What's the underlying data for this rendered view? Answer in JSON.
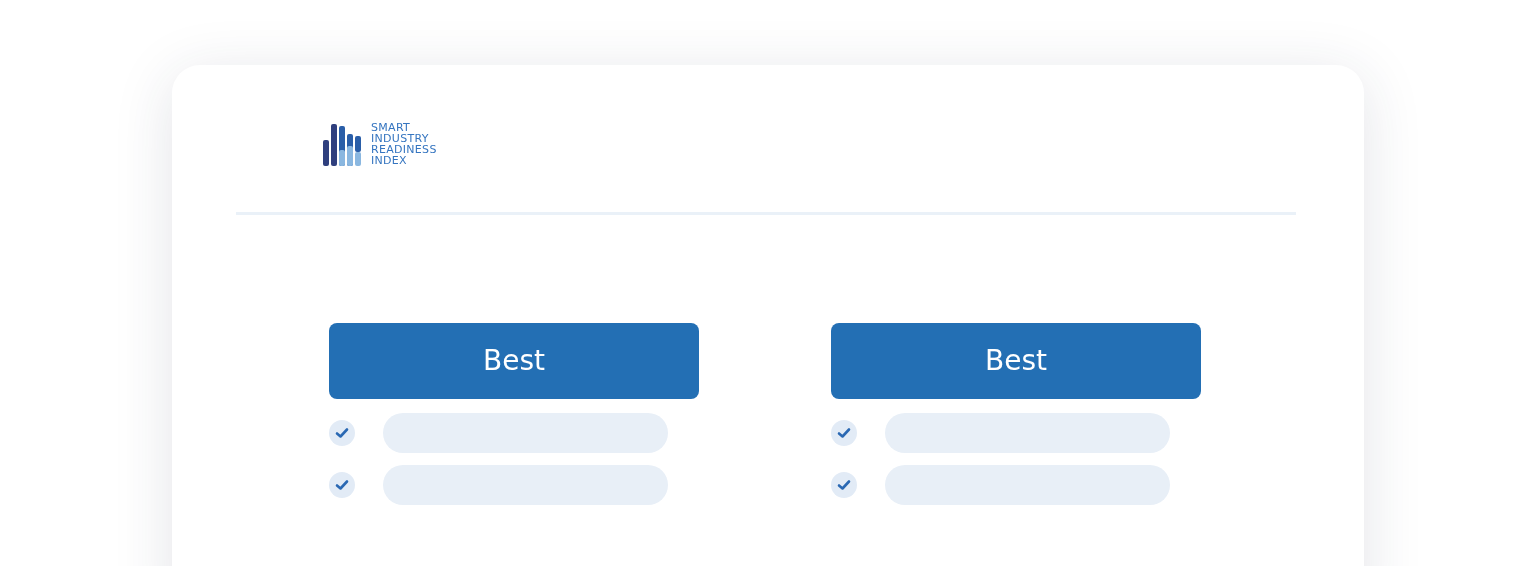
{
  "logo": {
    "lines": [
      "SMART",
      "INDUSTRY",
      "READINESS",
      "INDEX"
    ]
  },
  "plans": [
    {
      "title": "Best",
      "features": [
        {
          "checked": true
        },
        {
          "checked": true
        }
      ]
    },
    {
      "title": "Best",
      "features": [
        {
          "checked": true
        },
        {
          "checked": true
        }
      ]
    }
  ]
}
